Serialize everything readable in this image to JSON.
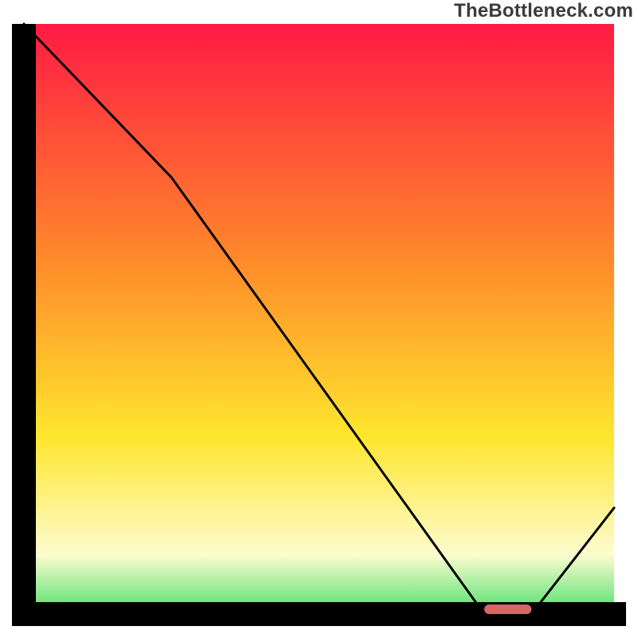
{
  "watermark": "TheBottleneck.com",
  "colors": {
    "curve": "#000000",
    "axis": "#000000",
    "marker": "#d86666",
    "gradient_top": "#ff1a44",
    "gradient_mid1": "#ff8a2a",
    "gradient_mid2": "#ffe62e",
    "gradient_pale": "#fdfccf",
    "gradient_green": "#4de06c"
  },
  "chart_data": {
    "type": "line",
    "title": "",
    "xlabel": "",
    "ylabel": "",
    "xlim": [
      0,
      100
    ],
    "ylim": [
      0,
      100
    ],
    "series": [
      {
        "name": "bottleneck-curve",
        "x": [
          0,
          25,
          78,
          86,
          100
        ],
        "values": [
          100,
          74,
          0,
          0,
          18
        ]
      }
    ],
    "marker": {
      "x_start": 78,
      "x_end": 86,
      "y": 0
    }
  }
}
